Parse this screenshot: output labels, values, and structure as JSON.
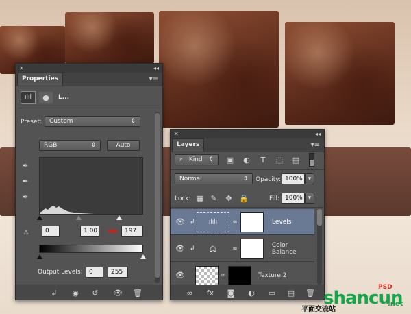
{
  "properties": {
    "tab": "Properties",
    "levels_abbrev": "L...",
    "preset_label": "Preset:",
    "preset_value": "Custom",
    "channel_value": "RGB",
    "auto_label": "Auto",
    "input_black": "0",
    "input_gamma": "1.00",
    "input_white": "197",
    "output_label": "Output Levels:",
    "output_black": "0",
    "output_white": "255"
  },
  "layers": {
    "tab": "Layers",
    "kind_label": "Kind",
    "blend_mode": "Normal",
    "opacity_label": "Opacity:",
    "opacity_value": "100%",
    "lock_label": "Lock:",
    "fill_label": "Fill:",
    "fill_value": "100%",
    "items": [
      {
        "name": "Levels"
      },
      {
        "name": "Color Balance"
      },
      {
        "name": "Texture 2"
      }
    ]
  },
  "watermark": {
    "site": "shancun",
    "domain": ".net",
    "left_text": "平面交流站",
    "red_text": "PSD"
  },
  "colors": {
    "panel": "#535353",
    "selected_row": "#6a7a95",
    "arrow": "#c0261c"
  }
}
